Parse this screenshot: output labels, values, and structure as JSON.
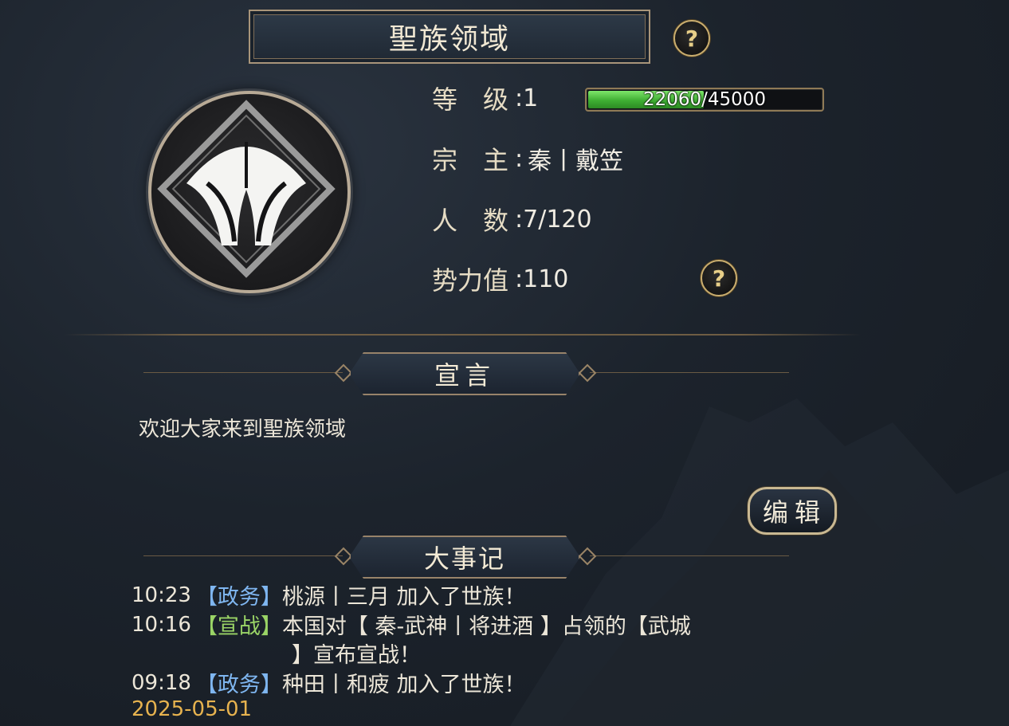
{
  "header": {
    "title": "聖族领域"
  },
  "info": {
    "level_label": "等　级",
    "level_value": "1",
    "xp": {
      "current": 22060,
      "max": 45000,
      "text": "22060/45000",
      "fill_fraction": 0.49
    },
    "leader_label": "宗　主",
    "leader_value": "秦丨戴笠",
    "members_label": "人　数",
    "members_value": "7/120",
    "power_label": "势力值",
    "power_value": "110",
    "colon": ":"
  },
  "declaration": {
    "header": "宣言",
    "text": "欢迎大家来到聖族领域",
    "edit_label": "编辑"
  },
  "events": {
    "header": "大事记",
    "items": [
      {
        "time": "10:23",
        "tag": "【政务】",
        "text": "桃源丨三月 加入了世族！"
      },
      {
        "time": "10:16",
        "tag": "【宣战】",
        "text": "本国对【 秦-武神丨将进酒 】占领的【武城",
        "text_cont": "】宣布宣战！"
      },
      {
        "time": "09:18",
        "tag": "【政务】",
        "text": "种田丨和疲 加入了世族！"
      }
    ],
    "date": "2025-05-01"
  },
  "colors": {
    "gold": "#c9ad6e",
    "tag_policy": "#7fb6f0",
    "tag_war": "#9ad466",
    "date": "#e7b34f",
    "xp_green": "#4cc23c"
  },
  "icons": {
    "help": "?",
    "emblem": "fan-emblem-icon"
  }
}
